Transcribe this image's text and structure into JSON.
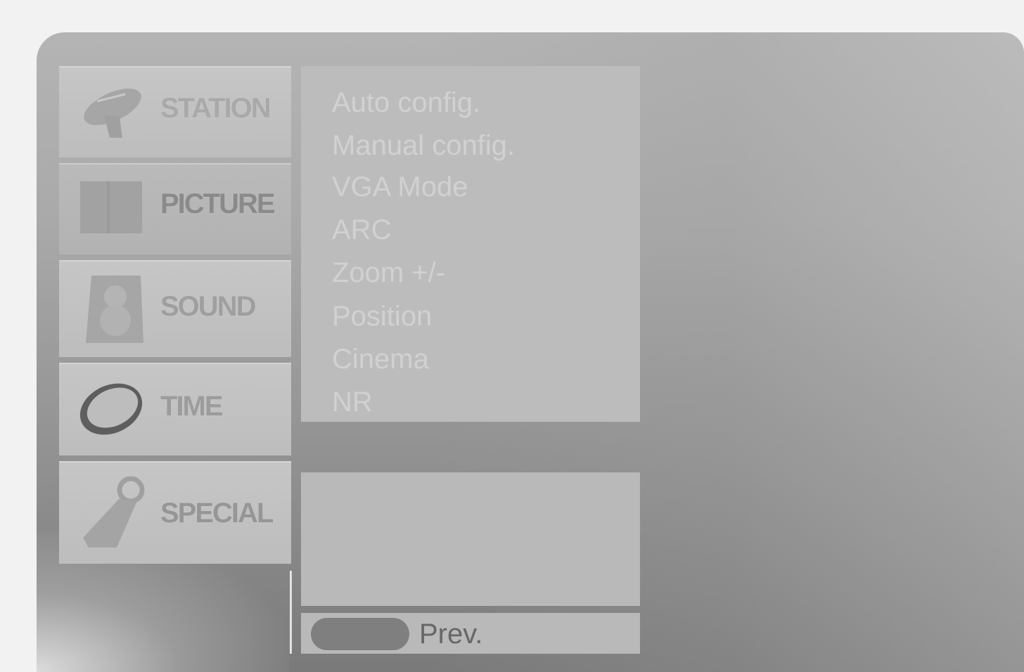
{
  "menu": {
    "tabs": [
      {
        "label": "STATION",
        "icon": "satellite-dish-icon"
      },
      {
        "label": "PICTURE",
        "icon": "picture-frame-icon"
      },
      {
        "label": "SOUND",
        "icon": "speaker-icon"
      },
      {
        "label": "TIME",
        "icon": "clock-ring-icon"
      },
      {
        "label": "SPECIAL",
        "icon": "key-tag-icon"
      }
    ],
    "active_tab": "PICTURE"
  },
  "submenu": {
    "items": [
      "Auto config.",
      "Manual config.",
      "VGA Mode",
      "ARC",
      "Zoom +/-",
      "Position",
      "Cinema",
      "NR"
    ]
  },
  "footer": {
    "prev_label": "Prev.",
    "prev_button_color": "#7f7f7f"
  },
  "colors": {
    "panel": "#bcbcbc",
    "background": "#a9a9a9"
  }
}
